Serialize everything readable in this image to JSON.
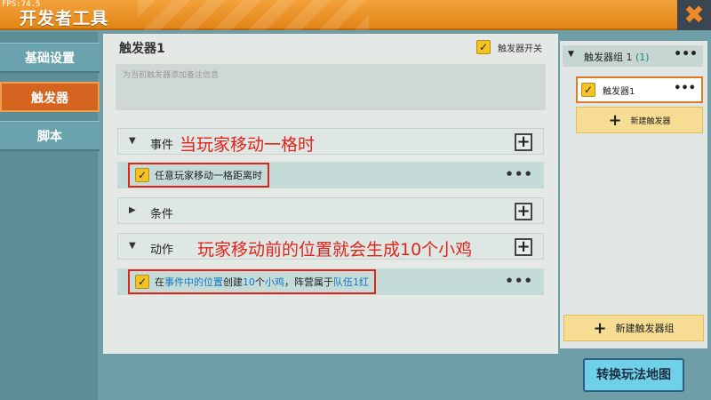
{
  "fps": "FPS:74.5",
  "window": {
    "title": "开发者工具",
    "close_icon": "✖"
  },
  "leftnav": [
    {
      "label": "基础设置"
    },
    {
      "label": "触发器"
    },
    {
      "label": "脚本"
    }
  ],
  "main": {
    "trigger_name": "触发器1",
    "switch_label": "触发器开关",
    "note_placeholder": "为当前触发器添加备注信息",
    "sections": {
      "event": {
        "label": "事件",
        "annotation": "当玩家移动一格时",
        "item": {
          "text": "任意玩家移动一格距离时"
        }
      },
      "condition": {
        "label": "条件"
      },
      "action": {
        "label": "动作",
        "annotation": "玩家移动前的位置就会生成10个小鸡",
        "item": {
          "p1": "在",
          "p2": "事件中的位置",
          "p3": "创建",
          "p4": "10",
          "p5": "个",
          "p6": "小鸡",
          "p7": "，阵营属于",
          "p8": "队伍1红"
        }
      }
    }
  },
  "right": {
    "group_label": "触发器组 1",
    "group_count": "(1)",
    "trigger_item": "触发器1",
    "new_trigger": "新建触发器",
    "new_group": "新建触发器组"
  },
  "switch_map_button": "转换玩法地图",
  "colors": {
    "accent": "#e28517",
    "annotation": "#e2231a",
    "highlight": "#1576c6"
  }
}
